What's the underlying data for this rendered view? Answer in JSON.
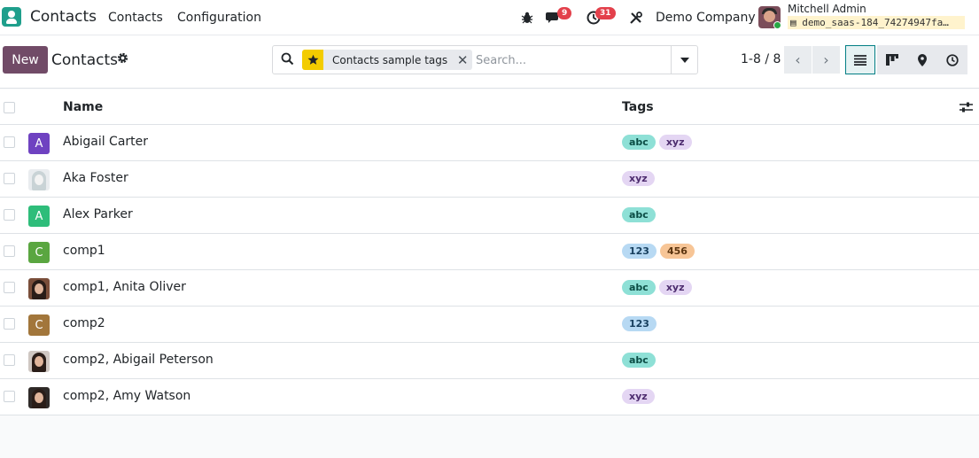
{
  "navbar": {
    "app_name": "Contacts",
    "menu": [
      "Contacts",
      "Configuration"
    ],
    "messages_badge": "9",
    "activities_badge": "31",
    "company": "Demo Company",
    "user_name": "Mitchell Admin",
    "database": "demo_saas-184_74274947fa…"
  },
  "control_panel": {
    "new_label": "New",
    "breadcrumb": "Contacts",
    "facet_label": "Contacts sample tags",
    "search_placeholder": "Search...",
    "pager": "1-8 / 8",
    "views": [
      "list-view-icon",
      "kanban-view-icon",
      "map-view-icon",
      "activity-view-icon"
    ],
    "active_view": "list"
  },
  "list": {
    "columns": [
      "Name",
      "Tags"
    ],
    "rows": [
      {
        "name": "Abigail Carter",
        "avatar": "A",
        "avatar_color": "#6f42c1",
        "tags": [
          "abc",
          "xyz"
        ]
      },
      {
        "name": "Aka Foster",
        "avatar": "",
        "avatar_color": "#e9ecef",
        "tags": [
          "xyz"
        ]
      },
      {
        "name": "Alex Parker",
        "avatar": "A",
        "avatar_color": "#2ebd7a",
        "tags": [
          "abc"
        ]
      },
      {
        "name": "comp1",
        "avatar": "C",
        "avatar_color": "#5aa640",
        "tags": [
          "123",
          "456"
        ]
      },
      {
        "name": "comp1, Anita Oliver",
        "avatar": "",
        "avatar_color": "#7a4e3a",
        "tags": [
          "abc",
          "xyz"
        ]
      },
      {
        "name": "comp2",
        "avatar": "C",
        "avatar_color": "#a2763b",
        "tags": [
          "123"
        ]
      },
      {
        "name": "comp2, Abigail Peterson",
        "avatar": "",
        "avatar_color": "#cfc7c2",
        "tags": [
          "abc"
        ]
      },
      {
        "name": "comp2, Amy Watson",
        "avatar": "",
        "avatar_color": "#2f2a28",
        "tags": [
          "xyz"
        ]
      }
    ],
    "tag_colors": {
      "abc": {
        "bg": "#8ee0d6",
        "fg": "#0b4d45"
      },
      "xyz": {
        "bg": "#e4d6f3",
        "fg": "#4d2c6f"
      },
      "123": {
        "bg": "#b7d9f3",
        "fg": "#173f5e"
      },
      "456": {
        "bg": "#f7c596",
        "fg": "#5c3510"
      }
    }
  }
}
